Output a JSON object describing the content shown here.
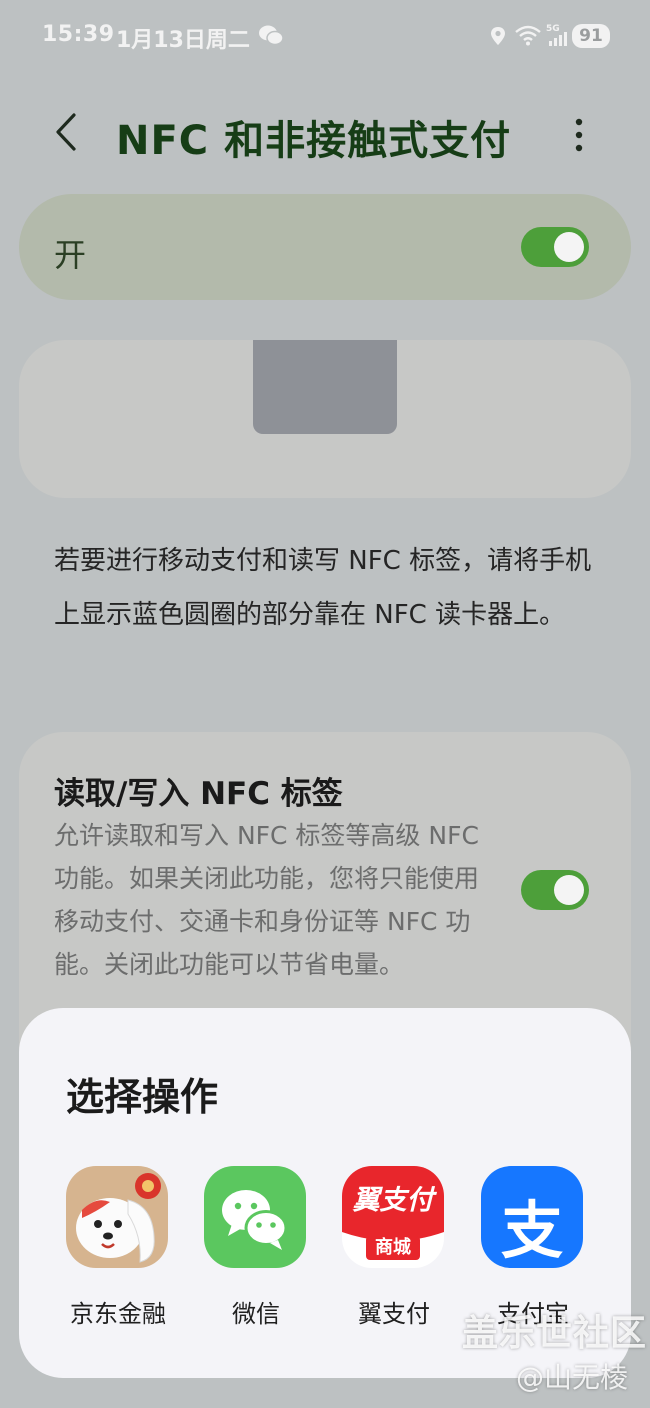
{
  "status_bar": {
    "time": "15:39",
    "date": "1月13日周二",
    "battery": "91",
    "icons": [
      "wechat-icon",
      "location-icon",
      "wifi-6-icon",
      "5g-signal-icon",
      "battery-icon"
    ]
  },
  "header": {
    "title": "NFC 和非接触式支付",
    "back_icon": "chevron-left-icon",
    "more_icon": "more-vertical-icon"
  },
  "main_switch": {
    "label": "开",
    "on": true
  },
  "description": "若要进行移动支付和读写 NFC 标签，请将手机上显示蓝色圆圈的部分靠在 NFC 读卡器上。",
  "tag_option": {
    "title": "读取/写入 NFC 标签",
    "description": "允许读取和写入 NFC 标签等高级 NFC 功能。如果关闭此功能，您将只能使用移动支付、交通卡和身份证等 NFC 功能。关闭此功能可以节省电量。",
    "on": true
  },
  "sheet": {
    "title": "选择操作",
    "apps": [
      {
        "label": "京东金融",
        "icon": "jd-finance-icon"
      },
      {
        "label": "微信",
        "icon": "wechat-icon"
      },
      {
        "label": "翼支付",
        "icon": "bestpay-icon",
        "icon_text_top": "翼支付",
        "icon_text_bottom": "商城"
      },
      {
        "label": "支付宝",
        "icon": "alipay-icon",
        "icon_glyph": "支"
      }
    ]
  },
  "watermark": {
    "line1": "盖乐世社区",
    "line2": "@山无棱"
  },
  "colors": {
    "toggle_on": "#4d9f3a",
    "title_green": "#163d16",
    "sheet_bg": "#f4f4f8"
  }
}
